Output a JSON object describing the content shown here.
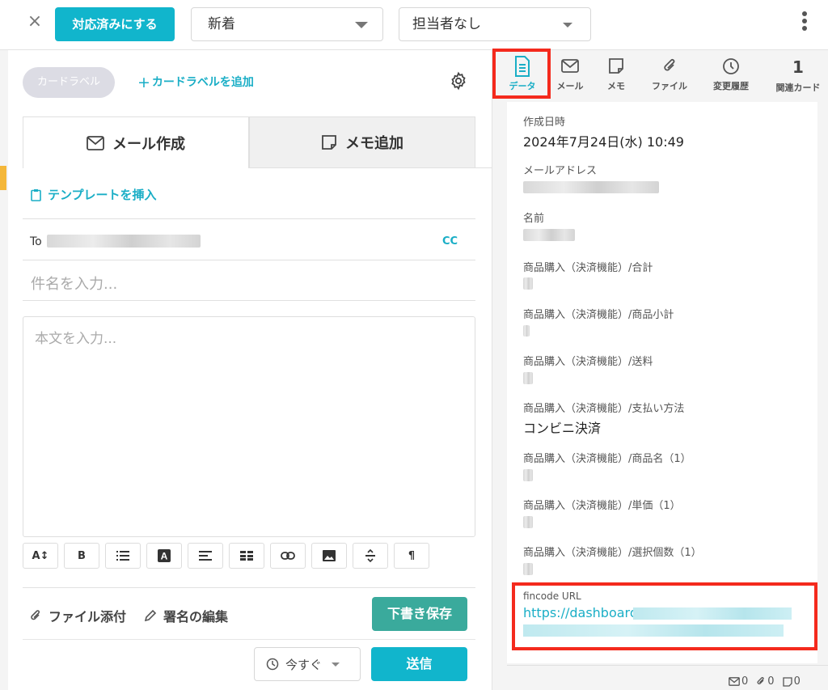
{
  "topbar": {
    "close_label": "×",
    "resolve_label": "対応済みにする",
    "status_value": "新着",
    "assignee_value": "担当者なし"
  },
  "compose": {
    "card_label_chip": "カードラベル",
    "add_card_label": "カードラベルを追加",
    "tab_mail": "メール作成",
    "tab_memo": "メモ追加",
    "insert_template": "テンプレートを挿入",
    "to_label": "To",
    "cc_label": "CC",
    "subject_placeholder": "件名を入力...",
    "body_placeholder": "本文を入力...",
    "toolbar": [
      "A↕",
      "B",
      "list",
      "A",
      "align",
      "table",
      "link",
      "image",
      "strike",
      "¶"
    ],
    "attach_file": "ファイル添付",
    "edit_signature": "署名の編集",
    "save_draft": "下書き保存",
    "schedule_value": "今すぐ",
    "send": "送信"
  },
  "side": {
    "tabs": [
      {
        "label": "データ",
        "icon": "document-icon",
        "active": true
      },
      {
        "label": "メール",
        "icon": "mail-icon"
      },
      {
        "label": "メモ",
        "icon": "note-icon"
      },
      {
        "label": "ファイル",
        "icon": "paperclip-icon"
      },
      {
        "label": "変更履歴",
        "icon": "clock-icon"
      },
      {
        "label": "関連カード",
        "count": "1"
      }
    ],
    "fields": {
      "created_label": "作成日時",
      "created_value": "2024年7月24日(水) 10:49",
      "email_label": "メールアドレス",
      "name_label": "名前",
      "total_label": "商品購入（決済機能）/合計",
      "subtotal_label": "商品購入（決済機能）/商品小計",
      "shipping_label": "商品購入（決済機能）/送料",
      "payment_label": "商品購入（決済機能）/支払い方法",
      "payment_value": "コンビニ決済",
      "product_name_label": "商品購入（決済機能）/商品名（1）",
      "unit_price_label": "商品購入（決済機能）/単価（1）",
      "qty_label": "商品購入（決済機能）/選択個数（1）",
      "fincode_label": "fincode URL",
      "fincode_value": "https://dashboard."
    },
    "counts": {
      "mail": "0",
      "file": "0",
      "memo": "0"
    }
  },
  "colors": {
    "accent": "#11b5cc",
    "draft": "#3aaa9c",
    "highlight": "#f42a1d"
  }
}
